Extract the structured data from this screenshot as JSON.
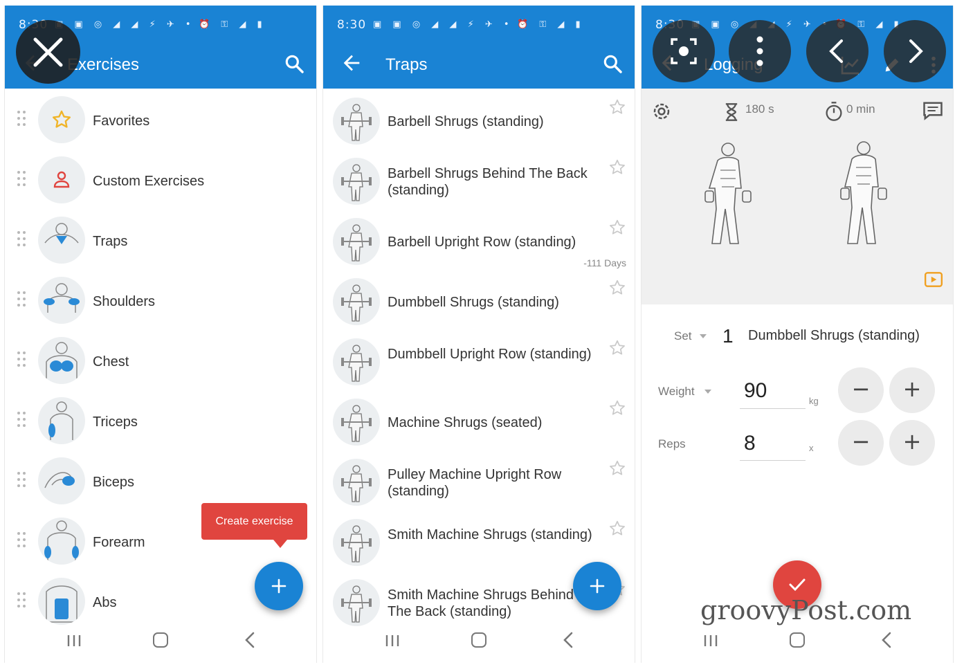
{
  "status_time": "8:30",
  "panel1": {
    "title": "Exercises",
    "categories": [
      {
        "label": "Favorites"
      },
      {
        "label": "Custom Exercises"
      },
      {
        "label": "Traps"
      },
      {
        "label": "Shoulders"
      },
      {
        "label": "Chest"
      },
      {
        "label": "Triceps"
      },
      {
        "label": "Biceps"
      },
      {
        "label": "Forearm"
      },
      {
        "label": "Abs"
      }
    ],
    "tooltip": "Create exercise"
  },
  "panel2": {
    "title": "Traps",
    "exercises": [
      {
        "name": "Barbell Shrugs (standing)"
      },
      {
        "name": "Barbell Shrugs Behind The Back (standing)"
      },
      {
        "name": "Barbell Upright Row (standing)",
        "days": "-111 Days"
      },
      {
        "name": "Dumbbell Shrugs (standing)"
      },
      {
        "name": "Dumbbell Upright Row (standing)"
      },
      {
        "name": "Machine Shrugs (seated)"
      },
      {
        "name": "Pulley Machine Upright Row (standing)"
      },
      {
        "name": "Smith Machine Shrugs (standing)"
      },
      {
        "name": "Smith Machine Shrugs Behind The Back (standing)"
      }
    ]
  },
  "panel3": {
    "title": "Logging",
    "rest": "180 s",
    "timer": "0 min",
    "set_label": "Set",
    "set_number": "1",
    "exercise": "Dumbbell Shrugs (standing)",
    "weight_label": "Weight",
    "weight_value": "90",
    "weight_unit": "kg",
    "reps_label": "Reps",
    "reps_value": "8",
    "reps_unit": "x",
    "minus": "−",
    "plus": "+"
  },
  "watermark": "groovyPost.com",
  "colors": {
    "appbar": "#1a83d4",
    "fab": "#1a83d4",
    "tooltip": "#e0453f",
    "confirm": "#e0453f",
    "muscle": "#2a8ad6"
  }
}
